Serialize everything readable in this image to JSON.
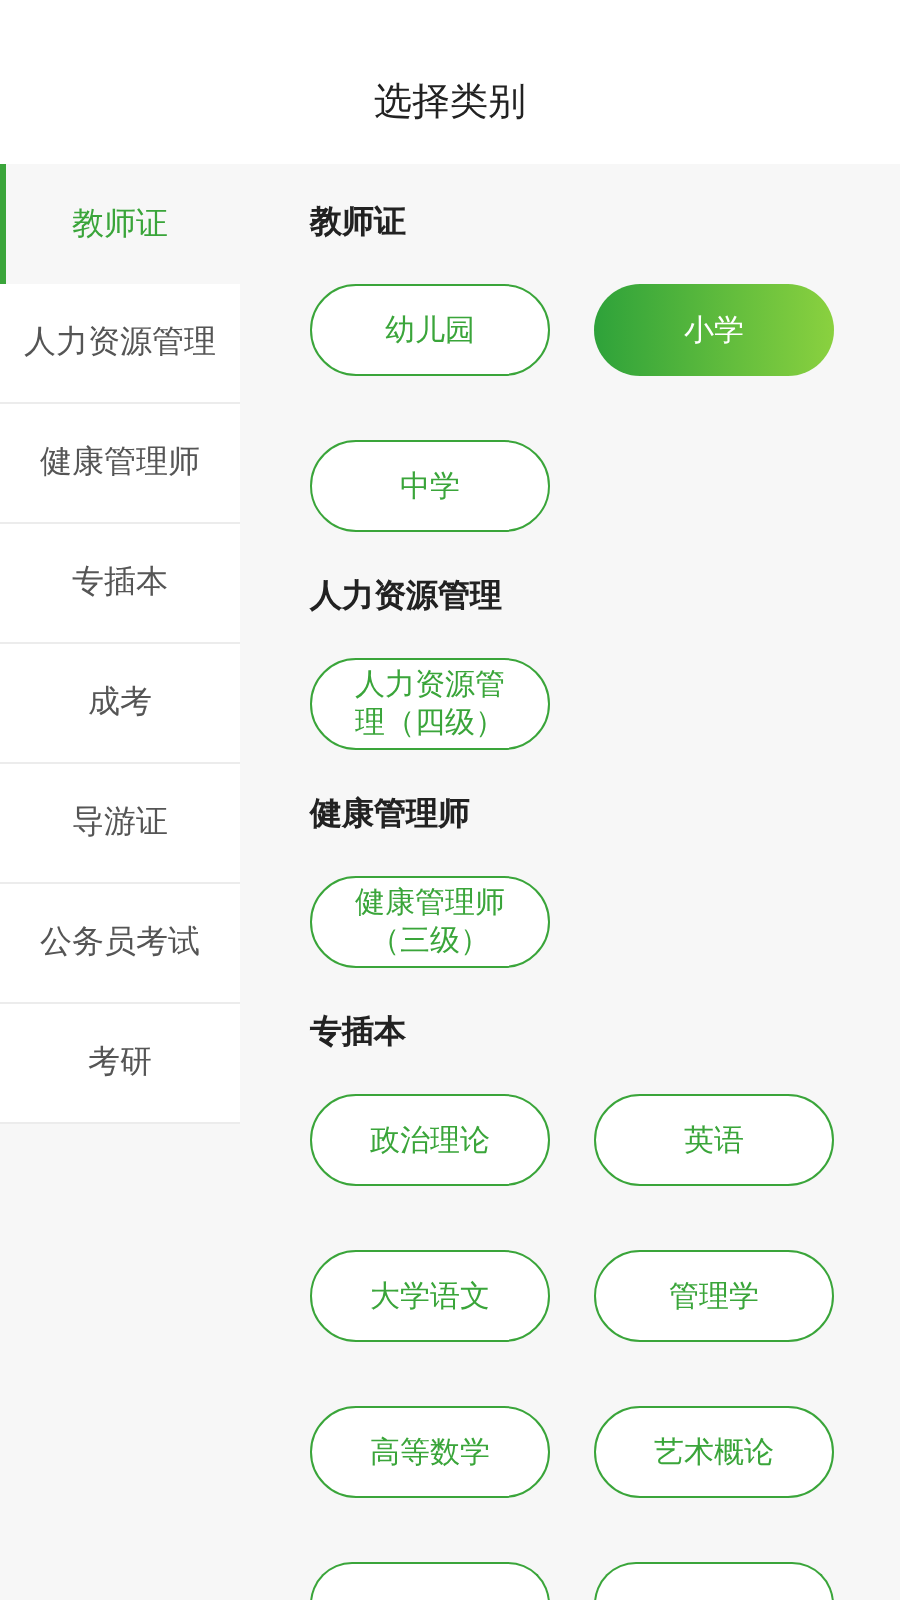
{
  "header": {
    "title": "选择类别"
  },
  "sidebar": {
    "items": [
      {
        "label": "教师证",
        "selected": true
      },
      {
        "label": "人力资源管理",
        "selected": false
      },
      {
        "label": "健康管理师",
        "selected": false
      },
      {
        "label": "专插本",
        "selected": false
      },
      {
        "label": "成考",
        "selected": false
      },
      {
        "label": "导游证",
        "selected": false
      },
      {
        "label": "公务员考试",
        "selected": false
      },
      {
        "label": "考研",
        "selected": false
      }
    ]
  },
  "sections": [
    {
      "title": "教师证",
      "options": [
        {
          "kind": "option",
          "label": "幼儿园",
          "selected": false
        },
        {
          "kind": "option",
          "label": "小学",
          "selected": true
        },
        {
          "kind": "option",
          "label": "中学",
          "selected": false
        }
      ]
    },
    {
      "title": "人力资源管理",
      "options": [
        {
          "kind": "option",
          "label": "人力资源管理（四级）",
          "selected": false
        }
      ]
    },
    {
      "title": "健康管理师",
      "options": [
        {
          "kind": "option",
          "label": "健康管理师（三级）",
          "selected": false
        }
      ]
    },
    {
      "title": "专插本",
      "options": [
        {
          "kind": "option",
          "label": "政治理论",
          "selected": false
        },
        {
          "kind": "option",
          "label": "英语",
          "selected": false
        },
        {
          "kind": "option",
          "label": "大学语文",
          "selected": false
        },
        {
          "kind": "option",
          "label": "管理学",
          "selected": false
        },
        {
          "kind": "option",
          "label": "高等数学",
          "selected": false
        },
        {
          "kind": "option",
          "label": "艺术概论",
          "selected": false
        },
        {
          "kind": "cut"
        },
        {
          "kind": "cut"
        }
      ]
    }
  ]
}
